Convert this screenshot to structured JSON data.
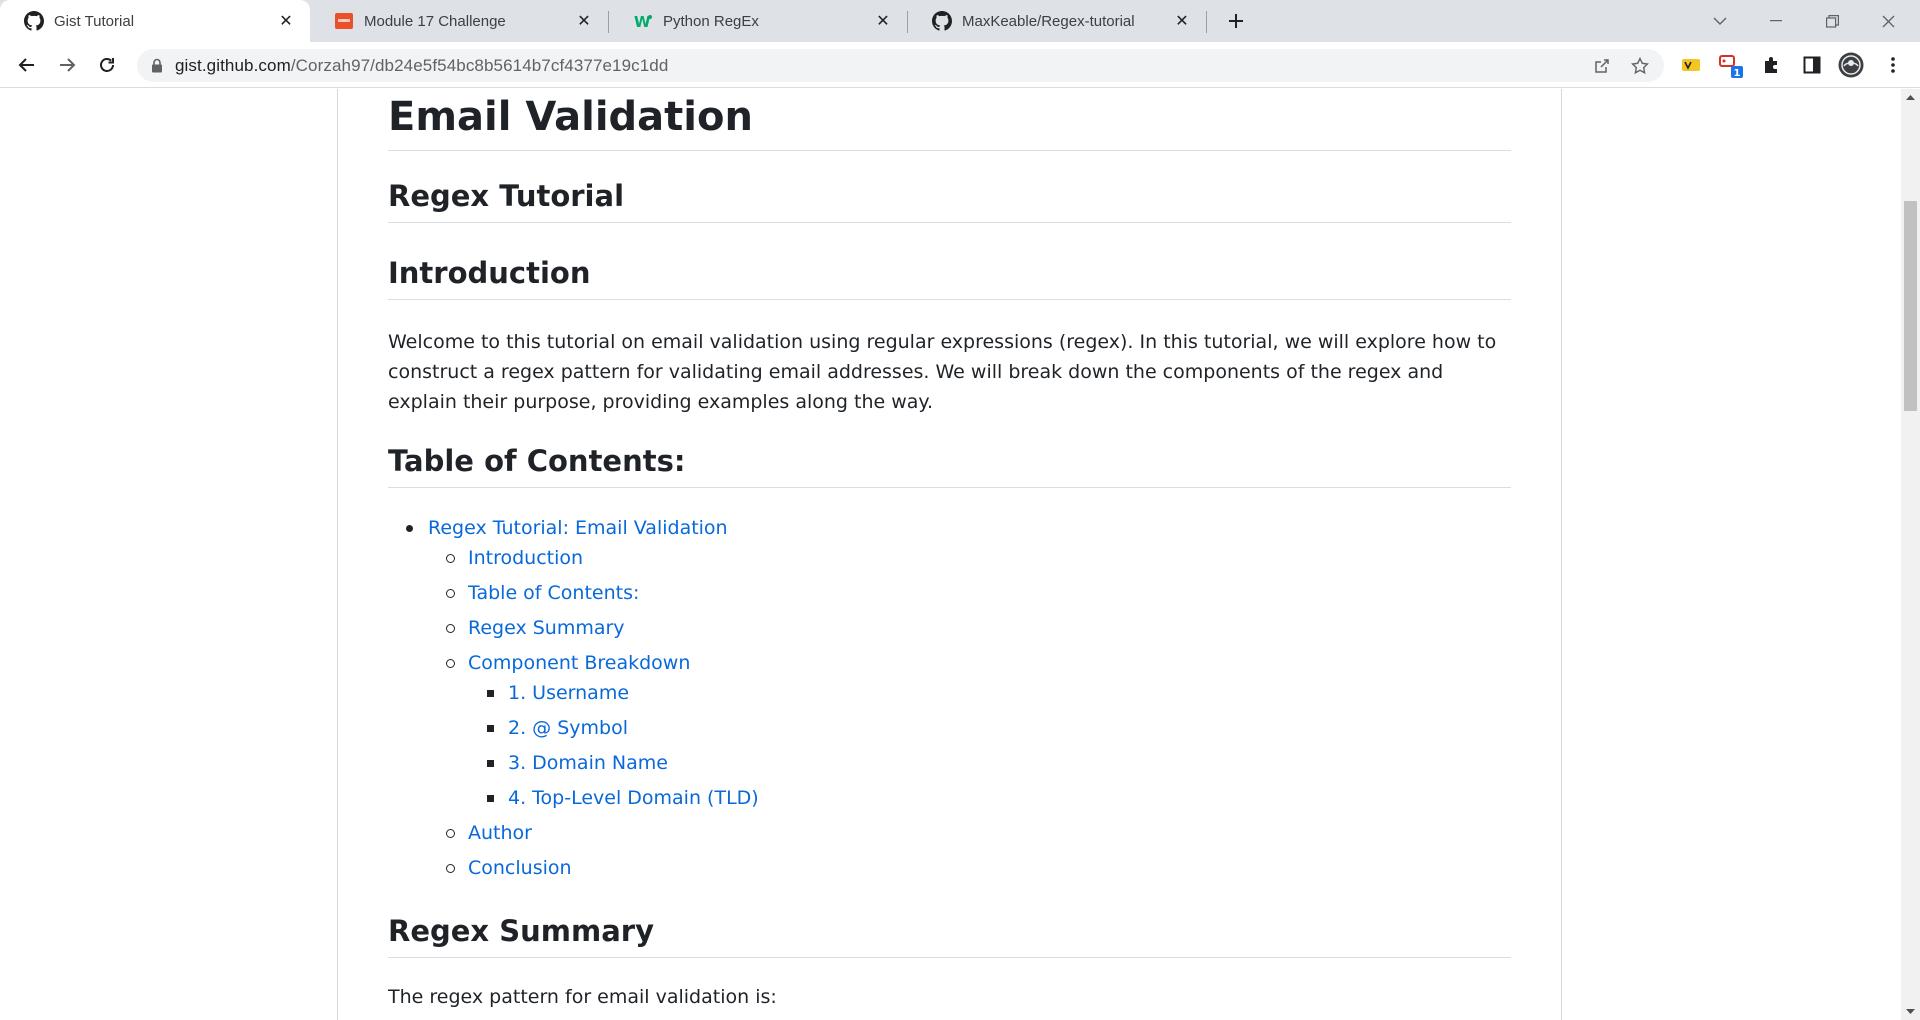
{
  "browser": {
    "tabs": [
      {
        "title": "Gist Tutorial",
        "icon": "github-icon",
        "active": true
      },
      {
        "title": "Module 17 Challenge",
        "icon": "module-icon",
        "active": false
      },
      {
        "title": "Python RegEx",
        "icon": "w3schools-icon",
        "active": false
      },
      {
        "title": "MaxKeable/Regex-tutorial",
        "icon": "github-icon",
        "active": false
      }
    ],
    "url_host": "gist.github.com",
    "url_path": "/Corzah97/db24e5f54bc8b5614b7cf4377e19c1dd",
    "extension_badge": "1"
  },
  "article": {
    "title": "Email Validation",
    "subtitle": "Regex Tutorial",
    "intro_heading": "Introduction",
    "intro_text": "Welcome to this tutorial on email validation using regular expressions (regex). In this tutorial, we will explore how to construct a regex pattern for validating email addresses. We will break down the components of the regex and explain their purpose, providing examples along the way.",
    "toc_heading": "Table of Contents:",
    "toc": {
      "top": "Regex Tutorial: Email Validation",
      "items": [
        "Introduction",
        "Table of Contents:",
        "Regex Summary",
        "Component Breakdown",
        "Author",
        "Conclusion"
      ],
      "sub_items": [
        "1. Username",
        "2. @ Symbol",
        "3. Domain Name",
        "4. Top-Level Domain (TLD)"
      ]
    },
    "summary_heading": "Regex Summary",
    "summary_text": "The regex pattern for email validation is:"
  },
  "colors": {
    "link": "#0969da",
    "text": "#1f2328",
    "tabstrip": "#dee1e6",
    "omnibox": "#f1f3f4"
  }
}
